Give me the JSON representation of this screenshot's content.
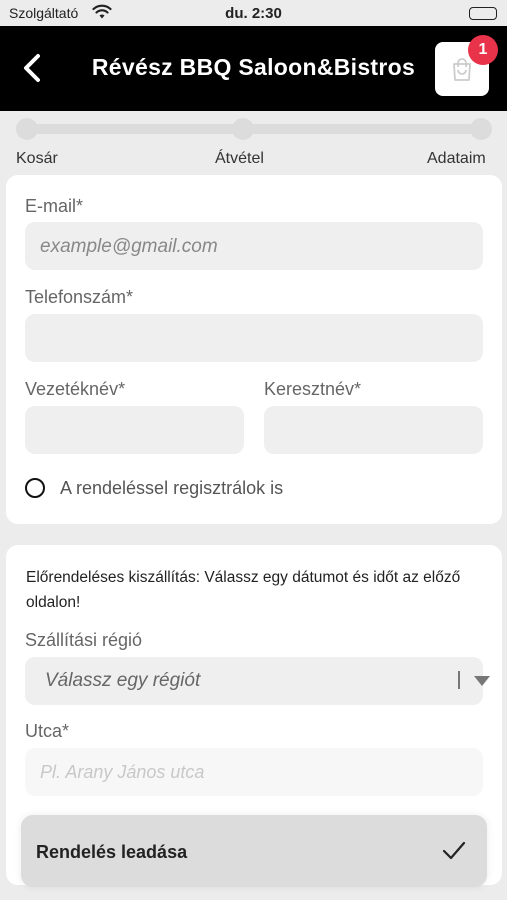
{
  "status_bar": {
    "carrier": "Szolgáltató",
    "time": "du. 2:30"
  },
  "header": {
    "title": "Révész BBQ Saloon&Bistros",
    "cart_count": "1"
  },
  "steps": [
    "Kosár",
    "Átvétel",
    "Adataim"
  ],
  "contact_form": {
    "email_label": "E-mail*",
    "email_placeholder": "example@gmail.com",
    "phone_label": "Telefonszám*",
    "lastname_label": "Vezetéknév*",
    "firstname_label": "Keresztnév*",
    "register_label": "A rendeléssel regisztrálok is"
  },
  "delivery": {
    "note": "Előrendeléses kiszállítás: Válassz egy dátumot és időt az előző oldalon!",
    "region_label": "Szállítási régió",
    "region_value": "Válassz egy régiót",
    "street_label": "Utca*",
    "street_placeholder": "Pl. Arany János utca"
  },
  "submit_label": "Rendelés leadása",
  "icons": {
    "back": "chevron-left-icon",
    "cart": "shopping-bag-icon",
    "submit": "checkmark-icon",
    "dropdown": "triangle-down-icon"
  },
  "colors": {
    "header_bg": "#000000",
    "badge": "#e8334a",
    "background": "#ececec"
  }
}
